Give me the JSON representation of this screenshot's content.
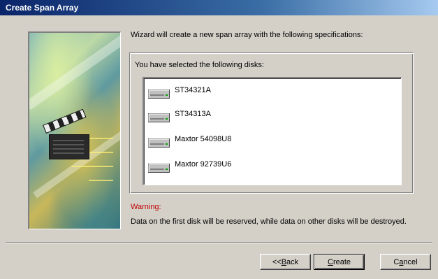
{
  "window": {
    "title": "Create Span Array"
  },
  "intro_text": "Wizard will create a new span array with the following specifications:",
  "disks_group": {
    "label": "You have selected the following disks:",
    "disks": [
      {
        "name": "ST34321A",
        "icon": "hard-drive-icon"
      },
      {
        "name": "ST34313A",
        "icon": "hard-drive-icon"
      },
      {
        "name": "Maxtor 54098U8",
        "icon": "hard-drive-icon"
      },
      {
        "name": "Maxtor 92739U6",
        "icon": "hard-drive-icon"
      }
    ]
  },
  "warning": {
    "label": "Warning:",
    "text": "Data on the first disk will be reserved, while data on other disks will be destroyed.",
    "color": "#c00000"
  },
  "buttons": {
    "back": {
      "prefix": "<<",
      "accel": "B",
      "rest": "ack"
    },
    "create": {
      "accel": "C",
      "rest": "reate"
    },
    "cancel": {
      "prefix": "C",
      "accel": "a",
      "rest": "ncel"
    }
  },
  "colors": {
    "title_bar_start": "#0a246a",
    "title_bar_end": "#a6caf0",
    "dialog_face": "#d4d0c8"
  }
}
